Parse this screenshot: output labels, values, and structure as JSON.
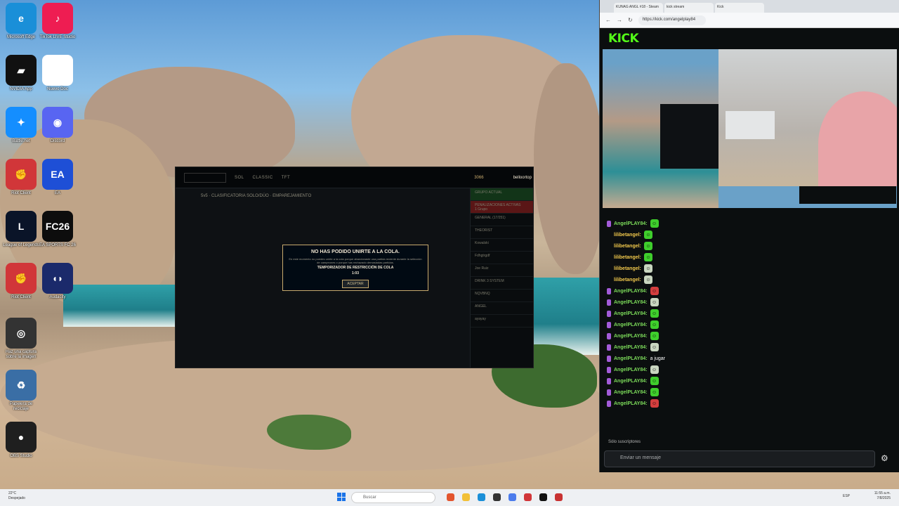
{
  "desktop": {
    "icons": [
      {
        "label": "Microsoft Edge",
        "glyph": "e",
        "color": "#1a8fd8",
        "icon": "edge-icon"
      },
      {
        "label": "TikTok LIVE Studio",
        "glyph": "♪",
        "color": "#ee1d52",
        "icon": "tiktok-icon"
      },
      {
        "label": "NVIDIA App",
        "glyph": "▰",
        "color": "#111111",
        "icon": "nvidia-icon"
      },
      {
        "label": "Nuevo Doc",
        "glyph": "",
        "color": "#ffffff",
        "icon": "document-icon"
      },
      {
        "label": "Battle.net",
        "glyph": "✦",
        "color": "#148eff",
        "icon": "battlenet-icon"
      },
      {
        "label": "Discord",
        "glyph": "◉",
        "color": "#5865f2",
        "icon": "discord-icon"
      },
      {
        "label": "Riot Client",
        "glyph": "✊",
        "color": "#d13639",
        "icon": "riot-icon"
      },
      {
        "label": "EA",
        "glyph": "EA",
        "color": "#1e4fd6",
        "icon": "ea-icon"
      },
      {
        "label": "League of Legends",
        "glyph": "L",
        "color": "#0a1428",
        "icon": "league-icon"
      },
      {
        "label": "EA SPORTS FC 26",
        "glyph": "FC26",
        "color": "#0d0d0d",
        "icon": "fc26-icon"
      },
      {
        "label": "Riot Client",
        "glyph": "✊",
        "color": "#d13639",
        "icon": "riot-icon-2"
      },
      {
        "label": "Audacity",
        "glyph": "◖◗",
        "color": "#1b2a6b",
        "icon": "audacity-icon"
      },
      {
        "label": "Haz una captura sobre la imagen",
        "glyph": "◎",
        "color": "#333333",
        "icon": "capture-icon"
      },
      {
        "label": "Papelera de reciclaje",
        "glyph": "♻",
        "color": "#3a6ea5",
        "icon": "recycle-bin-icon"
      },
      {
        "label": "OBS Studio",
        "glyph": "●",
        "color": "#1f1f1f",
        "icon": "obs-icon"
      }
    ]
  },
  "lol": {
    "tabs": [
      "SOL",
      "CLASSIC",
      "TFT"
    ],
    "mode_title": "5v5 · CLASIFICATORIA SOLO/DÚO · EMPAREJAMIENTO",
    "currency": "3066",
    "player": "belloortop",
    "modal": {
      "title": "NO HAS PODIDO UNIRTE A LA COLA.",
      "body": "En este momento no puedes unirte a la cola porque abandonaste una partida reciente durante la selección de campeones o porque has rechazado demasiadas partidas.",
      "timer_label": "TEMPORIZADOR DE RESTRICCIÓN DE COLA",
      "timer_value": "1:03",
      "accept": "ACEPTAR"
    },
    "side": {
      "group_label": "GRUPO ACTUAL",
      "warning_label": "PENALIZACIONES ACTIVAS",
      "warning_sub": "1 Grupo",
      "friends_label": "GENERAL (17/251)",
      "friends": [
        "THEORIST",
        "Kowalski",
        "Fdhgtrgdf",
        "Joe Ruiz",
        "DRINK 3 SYSTEM",
        "NQVBNQ",
        "ANGEL",
        "ayayay"
      ]
    }
  },
  "browser": {
    "tabs": [
      "KUNAG ANGL #18 - Steam",
      "kick stream",
      "Kick"
    ],
    "url": "https://kick.com/angelplay84",
    "logo": "KICK",
    "chat": [
      {
        "user": "AngelPLAY84:",
        "text": "",
        "emote": "green",
        "color": "#7cdc5a"
      },
      {
        "user": "lilibetangel:",
        "text": "",
        "emote": "green",
        "color": "#f2c94c"
      },
      {
        "user": "lilibetangel:",
        "text": "",
        "emote": "green",
        "color": "#f2c94c"
      },
      {
        "user": "lilibetangel:",
        "text": "",
        "emote": "green",
        "color": "#f2c94c"
      },
      {
        "user": "lilibetangel:",
        "text": "",
        "emote": "gray",
        "color": "#f2c94c"
      },
      {
        "user": "lilibetangel:",
        "text": "",
        "emote": "gray",
        "color": "#f2c94c"
      },
      {
        "user": "AngelPLAY84:",
        "text": "",
        "emote": "red",
        "color": "#7cdc5a"
      },
      {
        "user": "AngelPLAY84:",
        "text": "",
        "emote": "gray",
        "color": "#7cdc5a"
      },
      {
        "user": "AngelPLAY84:",
        "text": "",
        "emote": "green",
        "color": "#7cdc5a"
      },
      {
        "user": "AngelPLAY84:",
        "text": "",
        "emote": "green",
        "color": "#7cdc5a"
      },
      {
        "user": "AngelPLAY84:",
        "text": "",
        "emote": "green",
        "color": "#7cdc5a"
      },
      {
        "user": "AngelPLAY84:",
        "text": "",
        "emote": "gray",
        "color": "#7cdc5a"
      },
      {
        "user": "AngelPLAY84:",
        "text": "a jugar",
        "emote": "",
        "color": "#7cdc5a"
      },
      {
        "user": "AngelPLAY84:",
        "text": "",
        "emote": "gray",
        "color": "#7cdc5a"
      },
      {
        "user": "AngelPLAY84:",
        "text": "",
        "emote": "green",
        "color": "#7cdc5a"
      },
      {
        "user": "AngelPLAY84:",
        "text": "",
        "emote": "green",
        "color": "#7cdc5a"
      },
      {
        "user": "AngelPLAY84:",
        "text": "",
        "emote": "red",
        "color": "#7cdc5a"
      }
    ],
    "subs_only": "Sólo suscriptores",
    "chat_placeholder": "Enviar un mensaje"
  },
  "taskbar": {
    "weather_temp": "22°C",
    "weather_desc": "Despejado",
    "search": "Buscar",
    "lang": "ESP",
    "time": "11:55 a.m.",
    "date": "7/8/2025"
  }
}
